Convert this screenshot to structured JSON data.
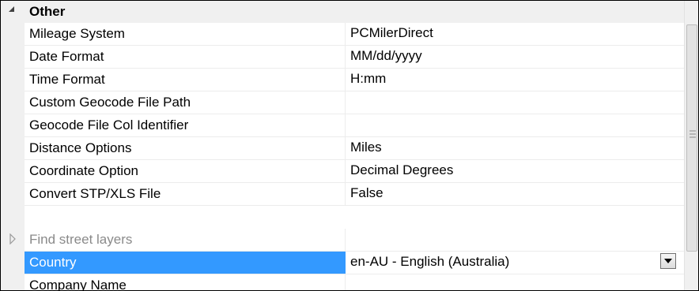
{
  "category": {
    "title": "Other",
    "icon": "collapse-triangle-icon"
  },
  "rows": [
    {
      "name": "Mileage System",
      "value": "PCMilerDirect"
    },
    {
      "name": "Date Format",
      "value": "MM/dd/yyyy"
    },
    {
      "name": "Time Format",
      "value": "H:mm"
    },
    {
      "name": "Custom Geocode File Path",
      "value": ""
    },
    {
      "name": "Geocode File Col Identifier",
      "value": ""
    },
    {
      "name": "Distance Options",
      "value": "Miles"
    },
    {
      "name": "Coordinate Option",
      "value": "Decimal Degrees"
    },
    {
      "name": "Convert STP/XLS File",
      "value": "False"
    },
    {
      "name": "Find street layers",
      "value": "",
      "state": "disabled",
      "icon": "expand-triangle-icon"
    },
    {
      "name": "Country",
      "value": "en-AU - English (Australia)",
      "state": "selected",
      "control": "dropdown",
      "icon": "chevron-down-icon"
    },
    {
      "name": "Company Name",
      "value": ""
    }
  ],
  "colors": {
    "selection": "#3399ff",
    "gutter": "#f0f0f0",
    "grid_line": "#ececec",
    "disabled_text": "#8a8a8a"
  }
}
